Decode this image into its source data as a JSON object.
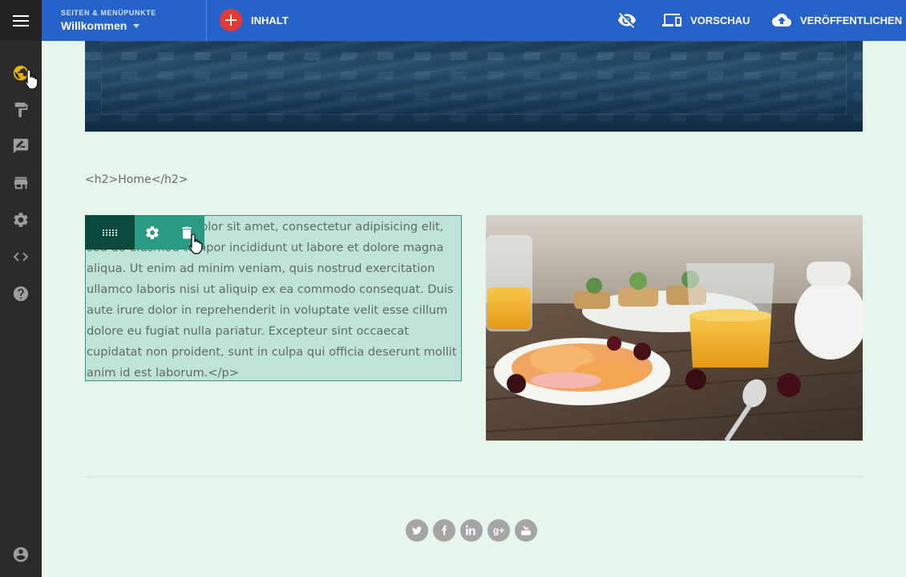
{
  "topbar": {
    "pages_caption": "SEITEN & MENÜPUNKTE",
    "pages_value": "Willkommen",
    "content_label": "INHALT",
    "preview_label": "VORSCHAU",
    "publish_label": "VERÖFFENTLICHEN",
    "accent": "#2562c9",
    "add_color": "#e53935"
  },
  "sidebar": {
    "items": [
      {
        "icon": "globe-icon",
        "active": true
      },
      {
        "icon": "paint-roller-icon"
      },
      {
        "icon": "edit-note-icon"
      },
      {
        "icon": "store-icon"
      },
      {
        "icon": "gear-icon"
      },
      {
        "icon": "code-icon"
      },
      {
        "icon": "help-icon"
      },
      {
        "icon": "account-icon"
      }
    ]
  },
  "content": {
    "heading_code": "<h2>Home</h2>",
    "paragraph": "<p>Lorem ipsum dolor sit amet, consectetur adipisicing elit, sed do eiusmod tempor incididunt ut labore et dolore magna aliqua. Ut enim ad minim veniam, quis nostrud exercitation ullamco laboris nisi ut aliquip ex ea commodo consequat. Duis aute irure dolor in reprehenderit in voluptate velit esse cillum dolore eu fugiat nulla pariatur. Excepteur sint occaecat cupidatat non proident, sunt in culpa qui officia deserunt mollit anim id est laborum.</p>"
  },
  "social": [
    "twitter-icon",
    "facebook-icon",
    "linkedin-icon",
    "google-plus-icon",
    "youtube-icon"
  ]
}
